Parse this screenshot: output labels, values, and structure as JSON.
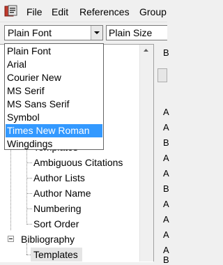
{
  "menubar": {
    "items": [
      "File",
      "Edit",
      "References",
      "Group"
    ]
  },
  "toolbar": {
    "font_value": "Plain Font",
    "size_value": "Plain Size"
  },
  "font_dropdown": {
    "options": [
      "Plain Font",
      "Arial",
      "Courier New",
      "MS Serif",
      "MS Sans Serif",
      "Symbol",
      "Times New Roman",
      "Wingdings"
    ],
    "selected": "Times New Roman"
  },
  "tree": {
    "partial_item": "Templates",
    "citation_children": [
      "Ambiguous Citations",
      "Author Lists",
      "Author Name",
      "Numbering",
      "Sort Order"
    ],
    "bibliography_label": "Bibliography",
    "bibliography_children": [
      "Templates"
    ]
  },
  "right_panel": {
    "fragments": [
      "B",
      "A",
      "A",
      "B",
      "A",
      "A",
      "B",
      "A",
      "A",
      "A",
      "A",
      "B"
    ]
  },
  "colors": {
    "selection": "#3399ff",
    "tree_selection": "#e5e5e5"
  },
  "icons": [
    "app-icon",
    "dropdown-arrow-icon",
    "scroll-up-arrow-icon",
    "expander-minus-icon"
  ]
}
